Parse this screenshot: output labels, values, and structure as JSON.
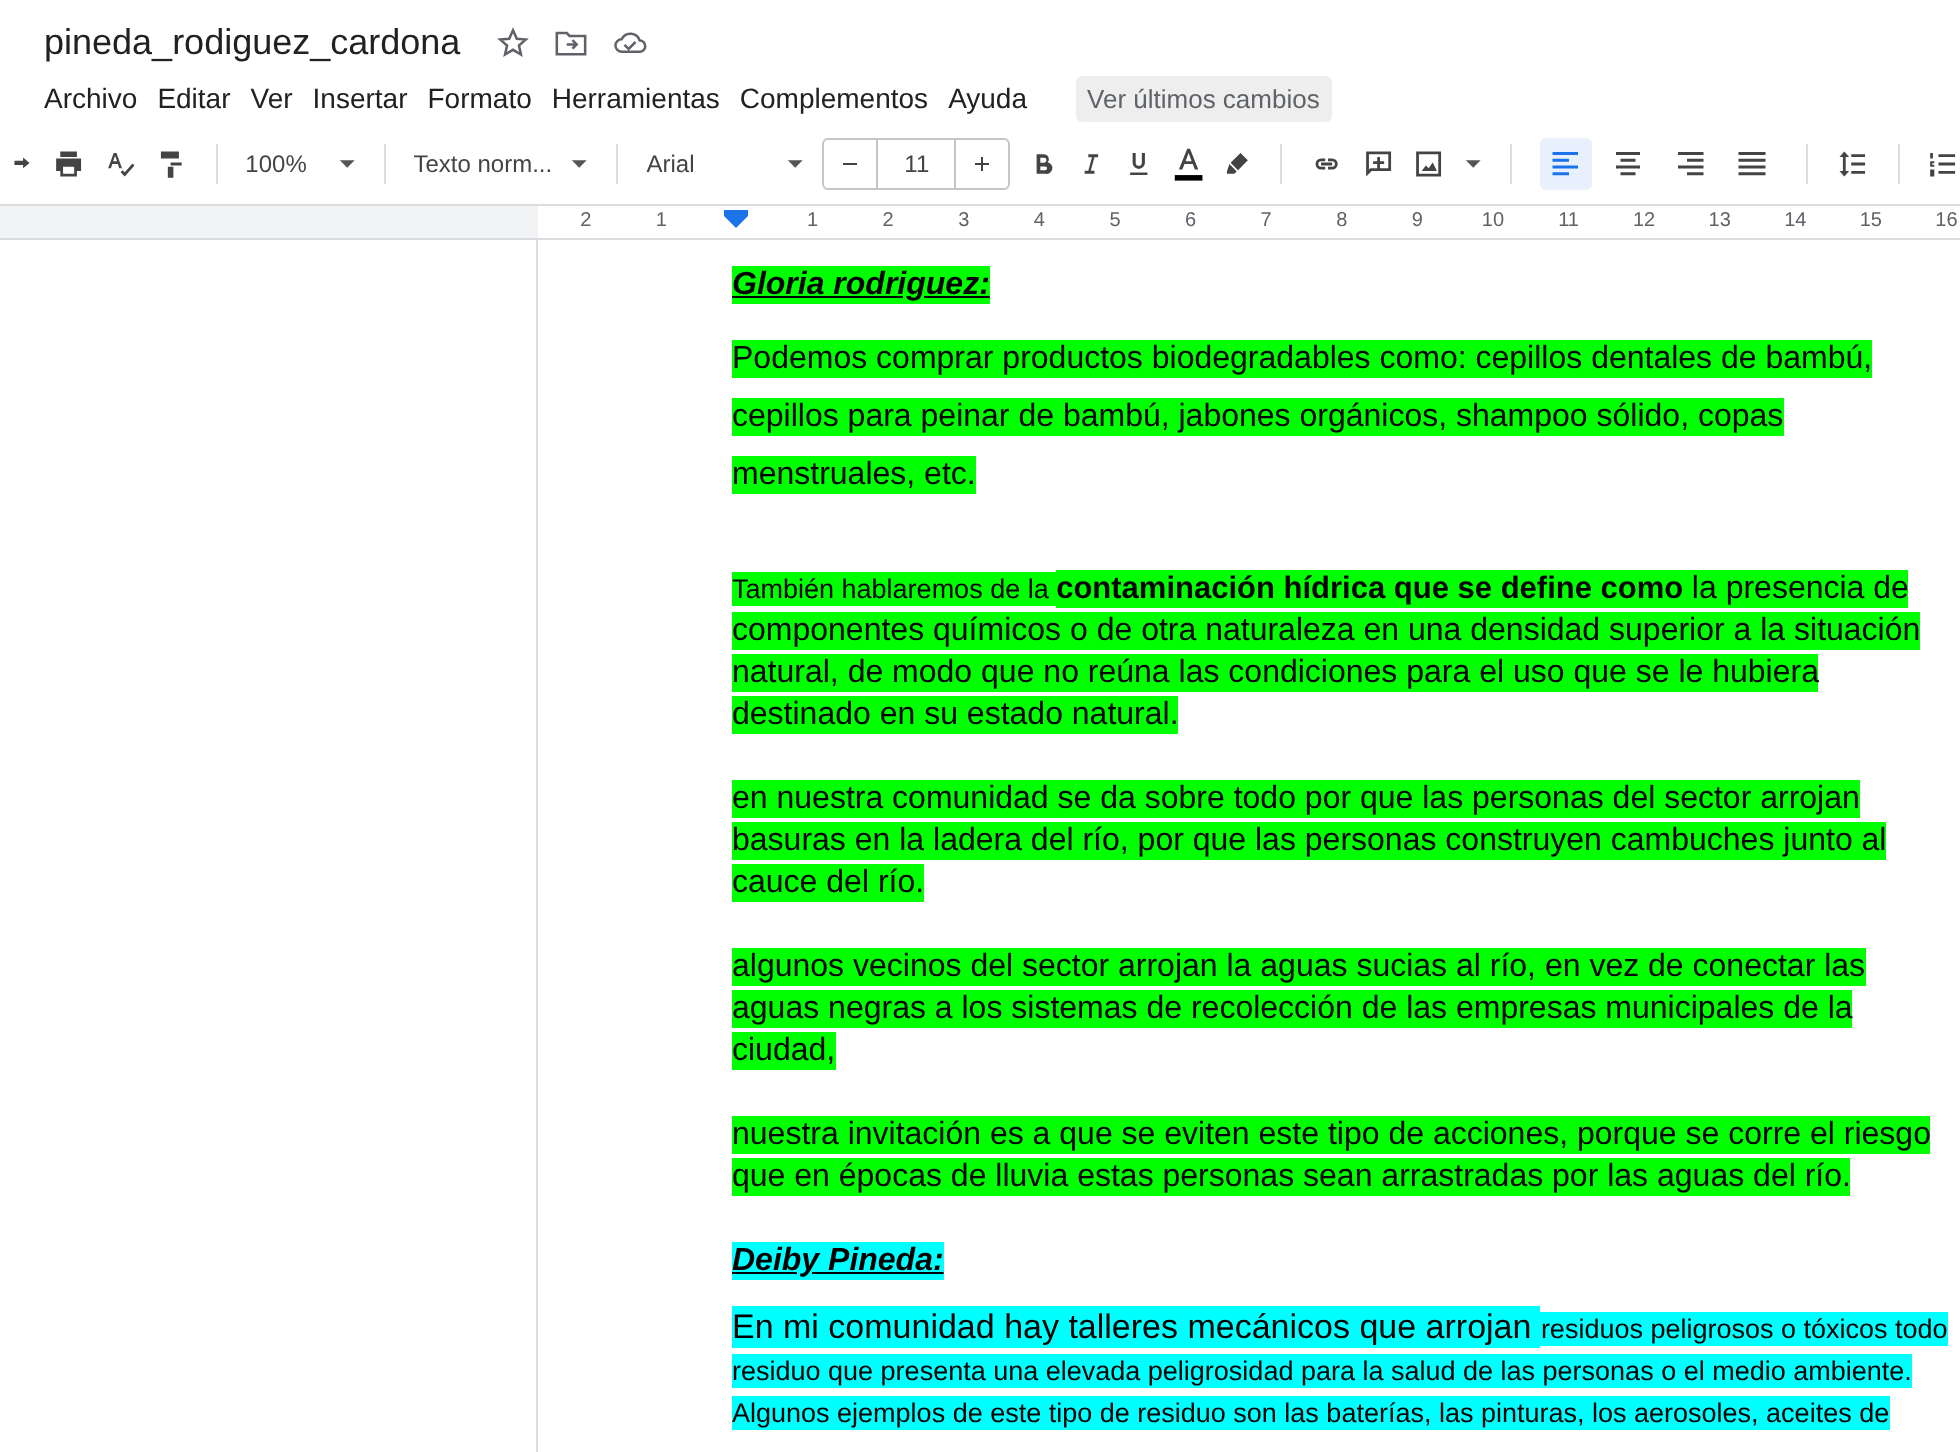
{
  "document": {
    "title": "pineda_rodiguez_cardona"
  },
  "menu": [
    "Archivo",
    "Editar",
    "Ver",
    "Insertar",
    "Formato",
    "Herramientas",
    "Complementos",
    "Ayuda"
  ],
  "last_changes_button": "Ver últimos cambios",
  "toolbar": {
    "zoom": "100%",
    "style": "Texto norm...",
    "font": "Arial",
    "font_size": "11",
    "alignments": [
      {
        "kind": "left",
        "selected": true
      },
      {
        "kind": "center",
        "selected": false
      },
      {
        "kind": "right",
        "selected": false
      },
      {
        "kind": "justify",
        "selected": false
      }
    ]
  },
  "ruler": {
    "before_indent": [
      "2",
      "1"
    ],
    "after_indent": [
      "1",
      "2",
      "3",
      "4",
      "5",
      "6",
      "7",
      "8",
      "9",
      "10",
      "11",
      "12",
      "13",
      "14",
      "15",
      "16"
    ]
  },
  "paragraphs": [
    {
      "kind": "heading",
      "color": "#00ff00",
      "runs": [
        {
          "kind": "normal",
          "text": "Gloria rodriguez:"
        }
      ]
    },
    {
      "kind": "wide",
      "color": "#00ff00",
      "runs": [
        {
          "kind": "normal",
          "text": "Podemos comprar productos biodegradables como: cepillos dentales de bambú, cepillos para peinar de bambú, jabones orgánicos, shampoo sólido, copas menstruales, etc."
        }
      ]
    },
    {
      "kind": "body",
      "color": "#00ff00",
      "runs": [
        {
          "kind": "small",
          "text": "También hablaremos de la "
        },
        {
          "kind": "bold",
          "text": "contaminación hídrica que se define como "
        },
        {
          "kind": "normal",
          "text": " la presencia de componentes químicos o de otra naturaleza en una densidad superior a la situación natural, de modo que no reúna las condiciones para el uso que se le hubiera destinado en su estado natural."
        }
      ]
    },
    {
      "kind": "body",
      "color": "#00ff00",
      "runs": [
        {
          "kind": "normal",
          "text": "en nuestra comunidad se da sobre todo por que las personas del sector arrojan basuras en la ladera del río, por que las personas construyen cambuches junto al cauce del río."
        }
      ]
    },
    {
      "kind": "body",
      "color": "#00ff00",
      "runs": [
        {
          "kind": "normal",
          "text": "algunos vecinos del sector arrojan la aguas sucias al río, en vez de conectar las aguas negras a los sistemas de recolección de las empresas municipales de la ciudad,"
        }
      ]
    },
    {
      "kind": "body",
      "color": "#00ff00",
      "runs": [
        {
          "kind": "normal",
          "text": "nuestra invitación es a que se eviten este tipo de acciones, porque se corre el riesgo que en épocas de lluvia estas personas sean arrastradas por las aguas del río."
        }
      ]
    },
    {
      "kind": "heading",
      "color": "#00ffff",
      "runs": [
        {
          "kind": "normal",
          "text": "Deiby Pineda:"
        }
      ]
    },
    {
      "kind": "body",
      "color": "#00ffff",
      "runs": [
        {
          "kind": "large",
          "text": "En mi comunidad hay talleres mecánicos que arrojan "
        },
        {
          "kind": "small",
          "text": "residuos peligrosos o tóxicos todo residuo que presenta una elevada peligrosidad para la salud de las personas o el medio ambiente. Algunos ejemplos de este tipo de residuo son las baterías, las pinturas, los aerosoles, aceites de"
        }
      ]
    }
  ]
}
